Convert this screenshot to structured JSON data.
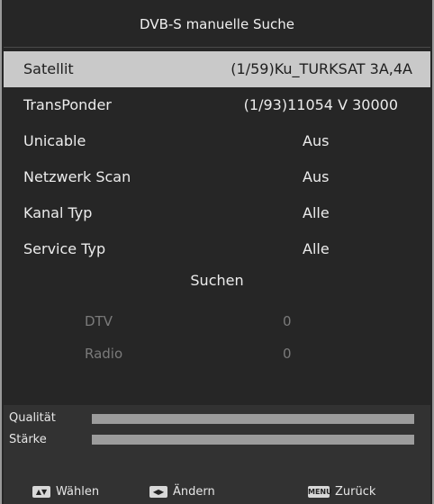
{
  "title": "DVB-S manuelle Suche",
  "menu": [
    {
      "label": "Satellit",
      "value": "(1/59)Ku_TURKSAT 3A,4A"
    },
    {
      "label": "TransPonder",
      "value": "(1/93)11054 V 30000"
    },
    {
      "label": "Unicable",
      "value": "Aus"
    },
    {
      "label": "Netzwerk Scan",
      "value": "Aus"
    },
    {
      "label": "Kanal Typ",
      "value": "Alle"
    },
    {
      "label": "Service Typ",
      "value": "Alle"
    }
  ],
  "search_label": "Suchen",
  "stats": [
    {
      "label": "DTV",
      "value": "0"
    },
    {
      "label": "Radio",
      "value": "0"
    }
  ],
  "signal": {
    "quality_label": "Qualität",
    "strength_label": "Stärke",
    "quality": 1.0,
    "strength": 1.0
  },
  "footer": {
    "select_label": "Wählen",
    "change_label": "Ändern",
    "back_key": "MENU",
    "back_label": "Zurück"
  },
  "colors": {
    "selected_row": "#c9c9c9",
    "background": "#262626"
  }
}
